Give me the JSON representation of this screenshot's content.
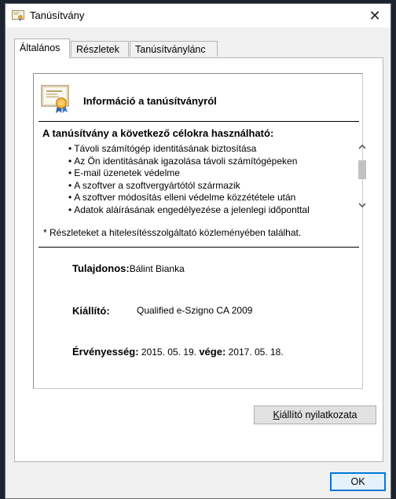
{
  "window": {
    "title": "Tanúsítvány",
    "close_glyph": "✕"
  },
  "tabs": [
    {
      "label": "Általános",
      "active": true
    },
    {
      "label": "Részletek",
      "active": false
    },
    {
      "label": "Tanúsítványlánc",
      "active": false
    }
  ],
  "info": {
    "header": "Információ a tanúsítványról",
    "purposes_title": "A tanúsítvány a következő célokra használható:",
    "purposes": [
      "Távoli számítógép identitásának biztosítása",
      "Az Ön identitásának igazolása távoli számítógépeken",
      "E-mail üzenetek védelme",
      "A szoftver a szoftvergyártótól származik",
      "A szoftver módosítás elleni védelme közzététele után",
      "Adatok aláírásának engedélyezése a jelenlegi időponttal"
    ],
    "footnote": "* Részleteket a hitelesítésszolgáltató közleményében találhat.",
    "owner_label": "Tulajdonos:",
    "owner_value": "Bálint Bianka",
    "issuer_label": "Kiállító:",
    "issuer_value": "Qualified e-Szigno CA 2009",
    "validity_label": "Érvényesség:",
    "valid_from": "2015. 05. 19.",
    "to_label": "vége:",
    "valid_to": "2017. 05. 18."
  },
  "buttons": {
    "issuer_statement_prefix": "K",
    "issuer_statement_rest": "iállító nyilatkozata",
    "ok": "OK"
  },
  "icons": {
    "title": "certificate-icon",
    "cert": "certificate-icon",
    "scroll_up": "chevron-up-icon",
    "scroll_down": "chevron-down-icon"
  }
}
